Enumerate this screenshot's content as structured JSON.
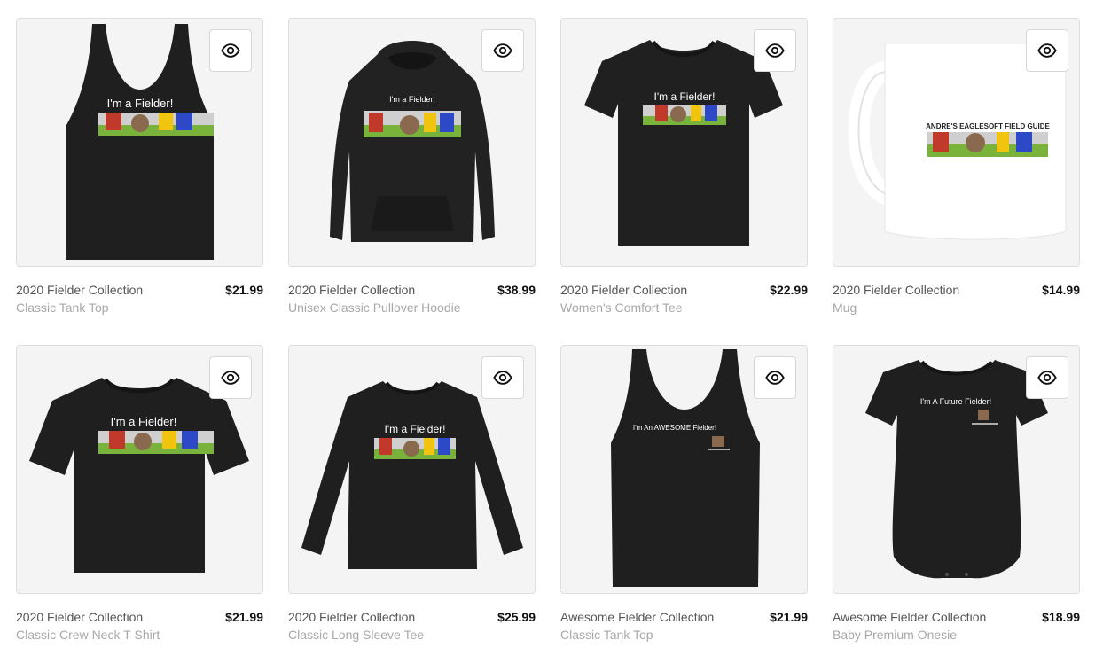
{
  "products": [
    {
      "collection": "2020 Fielder Collection",
      "type": "Classic Tank Top",
      "price": "$21.99",
      "print_title": "I'm a Fielder!",
      "garment": "tank"
    },
    {
      "collection": "2020 Fielder Collection",
      "type": "Unisex Classic Pullover Hoodie",
      "price": "$38.99",
      "print_title": "I'm a Fielder!",
      "garment": "hoodie"
    },
    {
      "collection": "2020 Fielder Collection",
      "type": "Women's Comfort Tee",
      "price": "$22.99",
      "print_title": "I'm a Fielder!",
      "garment": "womens-tee"
    },
    {
      "collection": "2020 Fielder Collection",
      "type": "Mug",
      "price": "$14.99",
      "print_title": "ANDRE'S EAGLESOFT FIELD GUIDE",
      "garment": "mug"
    },
    {
      "collection": "2020 Fielder Collection",
      "type": "Classic Crew Neck T-Shirt",
      "price": "$21.99",
      "print_title": "I'm a Fielder!",
      "garment": "tee"
    },
    {
      "collection": "2020 Fielder Collection",
      "type": "Classic Long Sleeve Tee",
      "price": "$25.99",
      "print_title": "I'm a Fielder!",
      "garment": "longsleeve"
    },
    {
      "collection": "Awesome Fielder Collection",
      "type": "Classic Tank Top",
      "price": "$21.99",
      "print_title": "I'm An AWESOME Fielder!",
      "garment": "tank2"
    },
    {
      "collection": "Awesome Fielder Collection",
      "type": "Baby Premium Onesie",
      "price": "$18.99",
      "print_title": "I'm A Future Fielder!",
      "garment": "onesie"
    }
  ],
  "icons": {
    "quick_view": "eye-icon"
  },
  "colors": {
    "garment": "#1e1e1e",
    "card_bg": "#f4f4f5",
    "price": "#111111",
    "subtitle": "#a8a8a8"
  }
}
